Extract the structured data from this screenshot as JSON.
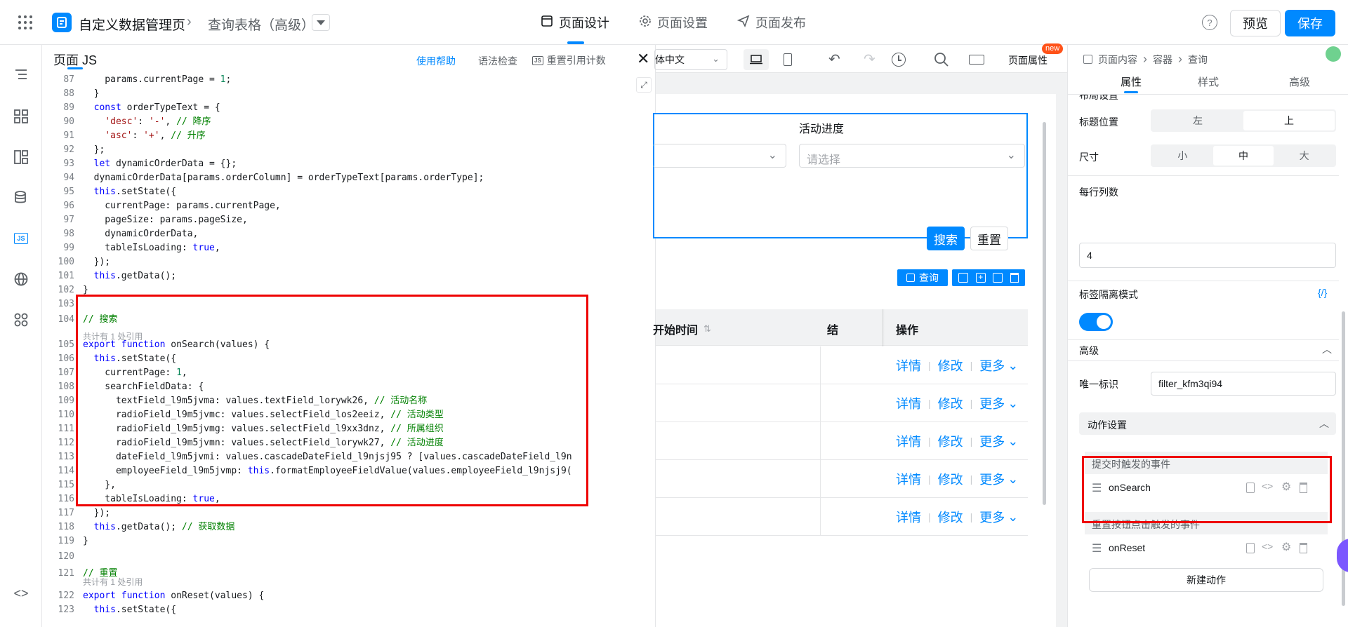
{
  "topbar": {
    "app_title": "自定义数据管理页",
    "breadcrumb_child": "查询表格（高级）",
    "tabs": [
      "页面设计",
      "页面设置",
      "页面发布"
    ],
    "preview_label": "预览",
    "save_label": "保存"
  },
  "js_panel": {
    "title": "页面 JS",
    "help": "使用帮助",
    "syntax_check": "语法检查",
    "reset_refs": "重置引用计数",
    "lines": [
      {
        "n": "87",
        "t": "    params.currentPage = 1;"
      },
      {
        "n": "88",
        "t": "  }"
      },
      {
        "n": "89",
        "t": "  const orderTypeText = {"
      },
      {
        "n": "90",
        "t": "    'desc': '-', // 降序"
      },
      {
        "n": "91",
        "t": "    'asc': '+', // 升序"
      },
      {
        "n": "92",
        "t": "  };"
      },
      {
        "n": "93",
        "t": "  let dynamicOrderData = {};"
      },
      {
        "n": "94",
        "t": "  dynamicOrderData[params.orderColumn] = orderTypeText[params.orderType];"
      },
      {
        "n": "95",
        "t": "  this.setState({"
      },
      {
        "n": "96",
        "t": "    currentPage: params.currentPage,"
      },
      {
        "n": "97",
        "t": "    pageSize: params.pageSize,"
      },
      {
        "n": "98",
        "t": "    dynamicOrderData,"
      },
      {
        "n": "99",
        "t": "    tableIsLoading: true,"
      },
      {
        "n": "100",
        "t": "  });"
      },
      {
        "n": "101",
        "t": "  this.getData();"
      },
      {
        "n": "102",
        "t": "}"
      },
      {
        "n": "103",
        "t": ""
      },
      {
        "n": "104",
        "t": "// 搜索"
      },
      {
        "n": "",
        "t": "共计有 1 处引用",
        "ref": true
      },
      {
        "n": "105",
        "t": "export function onSearch(values) {"
      },
      {
        "n": "106",
        "t": "  this.setState({"
      },
      {
        "n": "107",
        "t": "    currentPage: 1,"
      },
      {
        "n": "108",
        "t": "    searchFieldData: {"
      },
      {
        "n": "109",
        "t": "      textField_l9m5jvma: values.textField_lorywk26, // 活动名称"
      },
      {
        "n": "110",
        "t": "      radioField_l9m5jvmc: values.selectField_los2eeiz, // 活动类型"
      },
      {
        "n": "111",
        "t": "      radioField_l9m5jvmg: values.selectField_l9xx3dnz, // 所属组织"
      },
      {
        "n": "112",
        "t": "      radioField_l9m5jvmn: values.selectField_lorywk27, // 活动进度"
      },
      {
        "n": "113",
        "t": "      dateField_l9m5jvmi: values.cascadeDateField_l9njsj95 ? [values.cascadeDateField_l9n"
      },
      {
        "n": "114",
        "t": "      employeeField_l9m5jvmp: this.formatEmployeeFieldValue(values.employeeField_l9njsj9("
      },
      {
        "n": "115",
        "t": "    },"
      },
      {
        "n": "116",
        "t": "    tableIsLoading: true,"
      },
      {
        "n": "117",
        "t": "  });"
      },
      {
        "n": "118",
        "t": "  this.getData(); // 获取数据"
      },
      {
        "n": "119",
        "t": "}"
      },
      {
        "n": "120",
        "t": ""
      },
      {
        "n": "121",
        "t": "// 重置"
      },
      {
        "n": "",
        "t": "共计有 1 处引用",
        "ref": true
      },
      {
        "n": "122",
        "t": "export function onReset(values) {"
      },
      {
        "n": "123",
        "t": "  this.setState({"
      }
    ]
  },
  "canvas": {
    "lang_select": "体中文",
    "page_attr": "页面属性",
    "new_badge": "new",
    "progress_label": "活动进度",
    "select_placeholder": "请选择",
    "search_btn": "搜索",
    "reset_btn": "重置",
    "query_tag": "查询",
    "col_start_time": "开始时间",
    "col_end_partial": "结",
    "col_actions": "操作",
    "row_actions": {
      "detail": "详情",
      "edit": "修改",
      "more": "更多"
    },
    "row_count": 5
  },
  "right_panel": {
    "breadcrumb": [
      "页面内容",
      "容器",
      "查询"
    ],
    "tabs": [
      "属性",
      "样式",
      "高级"
    ],
    "cut_label": "布局设置",
    "title_position": {
      "label": "标题位置",
      "options": [
        "左",
        "上"
      ],
      "selected": "上"
    },
    "size": {
      "label": "尺寸",
      "options": [
        "小",
        "中",
        "大"
      ],
      "selected": "中"
    },
    "columns_per_row": {
      "label": "每行列数",
      "value": "4"
    },
    "tag_isolation": {
      "label": "标签隔离模式",
      "code_icon": "{/}",
      "enabled": true
    },
    "advanced": "高级",
    "unique_id": {
      "label": "唯一标识",
      "value": "filter_kfm3qi94"
    },
    "action_settings": "动作设置",
    "submit_event": {
      "label": "提交时触发的事件",
      "handler": "onSearch"
    },
    "reset_event": {
      "label": "重置按钮点击触发的事件",
      "handler": "onReset"
    },
    "new_action": "新建动作"
  },
  "colors": {
    "accent": "#0089ff",
    "highlight": "#ee0000"
  }
}
